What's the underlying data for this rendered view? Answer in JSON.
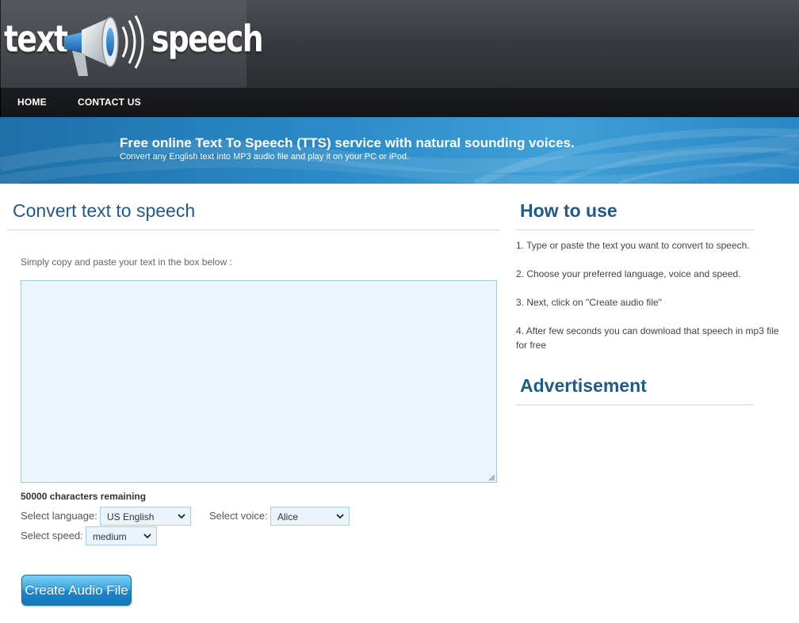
{
  "header": {
    "logo_word_1": "text",
    "logo_word_2": "speech",
    "logo_icon": "megaphone-icon"
  },
  "nav": {
    "items": [
      {
        "label": "HOME"
      },
      {
        "label": "CONTACT US"
      }
    ]
  },
  "banner": {
    "title": "Free online Text To Speech (TTS) service with natural sounding voices.",
    "subtitle": "Convert any English text into MP3 audio file and play it on your PC or iPod."
  },
  "converter": {
    "title": "Convert text to speech",
    "instructions": "Simply copy and paste your text in the box below :",
    "text_value": "",
    "char_count": "50000 characters remaining",
    "language_label": "Select language:",
    "language_value": "US English",
    "voice_label": "Select voice:",
    "voice_value": "Alice",
    "speed_label": "Select speed:",
    "speed_value": "medium",
    "create_button": "Create Audio File"
  },
  "how_to": {
    "title": "How to use",
    "steps": [
      "1. Type or paste the text you want to convert to speech.",
      "2. Choose your preferred language, voice and speed.",
      "3. Next, click on \"Create audio file\"",
      "4. After few seconds you can download that speech in mp3 file for free"
    ]
  },
  "advertisement": {
    "title": "Advertisement"
  },
  "colors": {
    "accent": "#1e5a8a",
    "banner": "#2a8ac7",
    "nav": "#17181a"
  }
}
